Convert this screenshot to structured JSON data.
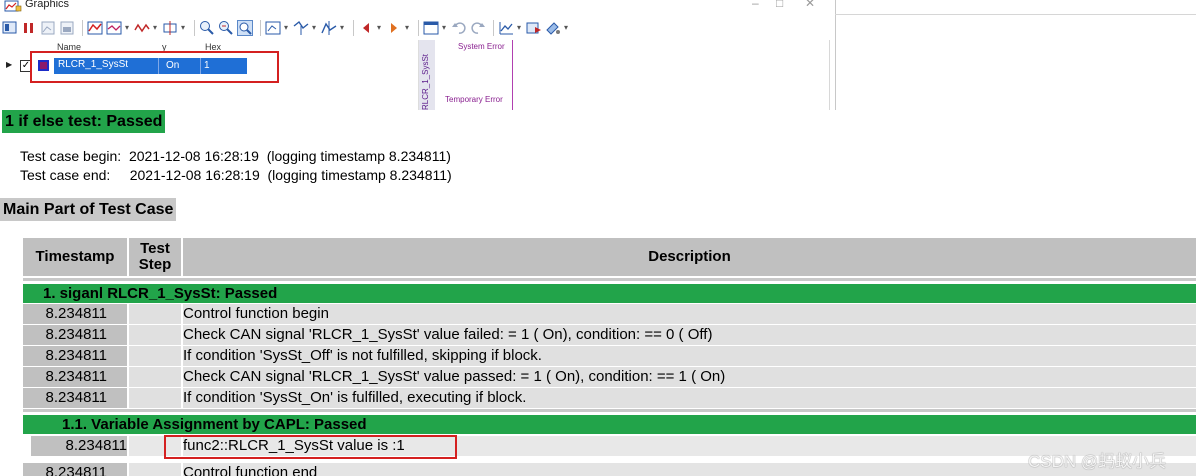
{
  "graphics_window": {
    "title": "Graphics",
    "controls": {
      "minimize": "–",
      "maximize": "□",
      "close": "✕"
    },
    "toolbar_icons": [
      "layout-icon",
      "pause-icon",
      "zoom-in-icon",
      "zoom-out-icon",
      "fit-icon",
      "measure-icon",
      "signal-icon",
      "marker-icon",
      "zoom-window-icon",
      "zoom-fit-icon",
      "zoom-selection-icon",
      "axis-icon",
      "cursor-icon",
      "trigger-icon",
      "previous-icon",
      "next-icon",
      "window-icon",
      "undo-icon",
      "redo-icon",
      "chart-icon",
      "export-icon",
      "paint-icon"
    ],
    "signal_list": {
      "headers": {
        "name": "Name",
        "y": "y",
        "hex": "Hex"
      },
      "row": {
        "name": "RLCR_1_SysSt",
        "y": "On",
        "hex": "1",
        "checked": true,
        "color": "#8b1a6b"
      }
    },
    "plot": {
      "y_axis_signal": "RLCR_1_SysSt",
      "y_labels": [
        "System Error",
        "Temporary Error"
      ]
    }
  },
  "report": {
    "test_title": "1 if else test: Passed",
    "begin_label": "Test case begin:",
    "begin_value": "2021-12-08 16:28:19  (logging timestamp 8.234811)",
    "end_label": "Test case end:",
    "end_value": "2021-12-08 16:28:19  (logging timestamp 8.234811)",
    "main_part_title": "Main Part of Test Case",
    "table_headers": {
      "timestamp": "Timestamp",
      "step": "Test Step",
      "description": "Description"
    },
    "group1_title": "1. siganl RLCR_1_SysSt: Passed",
    "group1_rows": [
      {
        "ts": "8.234811",
        "step": "",
        "desc": "Control function begin"
      },
      {
        "ts": "8.234811",
        "step": "",
        "desc": "Check CAN signal 'RLCR_1_SysSt' value failed: = 1 ( On), condition: == 0 ( Off)"
      },
      {
        "ts": "8.234811",
        "step": "",
        "desc": "If condition 'SysSt_Off' is not fulfilled, skipping if block."
      },
      {
        "ts": "8.234811",
        "step": "",
        "desc": "Check CAN signal 'RLCR_1_SysSt' value passed: = 1 ( On), condition: == 1 ( On)"
      },
      {
        "ts": "8.234811",
        "step": "",
        "desc": "If condition 'SysSt_On' is fulfilled, executing if block."
      }
    ],
    "group2_title": "1.1. Variable Assignment by CAPL: Passed",
    "group2_rows": [
      {
        "ts": "8.234811",
        "step": "",
        "desc": "func2::RLCR_1_SysSt value is :1"
      }
    ],
    "last_row": {
      "ts": "8.234811",
      "step": "",
      "desc": "Control function end"
    }
  },
  "colors": {
    "passed_green": "#22a44a",
    "header_gray": "#c0c0c0",
    "highlight_red": "#d42020",
    "selection_blue": "#1f6fd6"
  },
  "watermark": "CSDN @蚂蚁小兵"
}
